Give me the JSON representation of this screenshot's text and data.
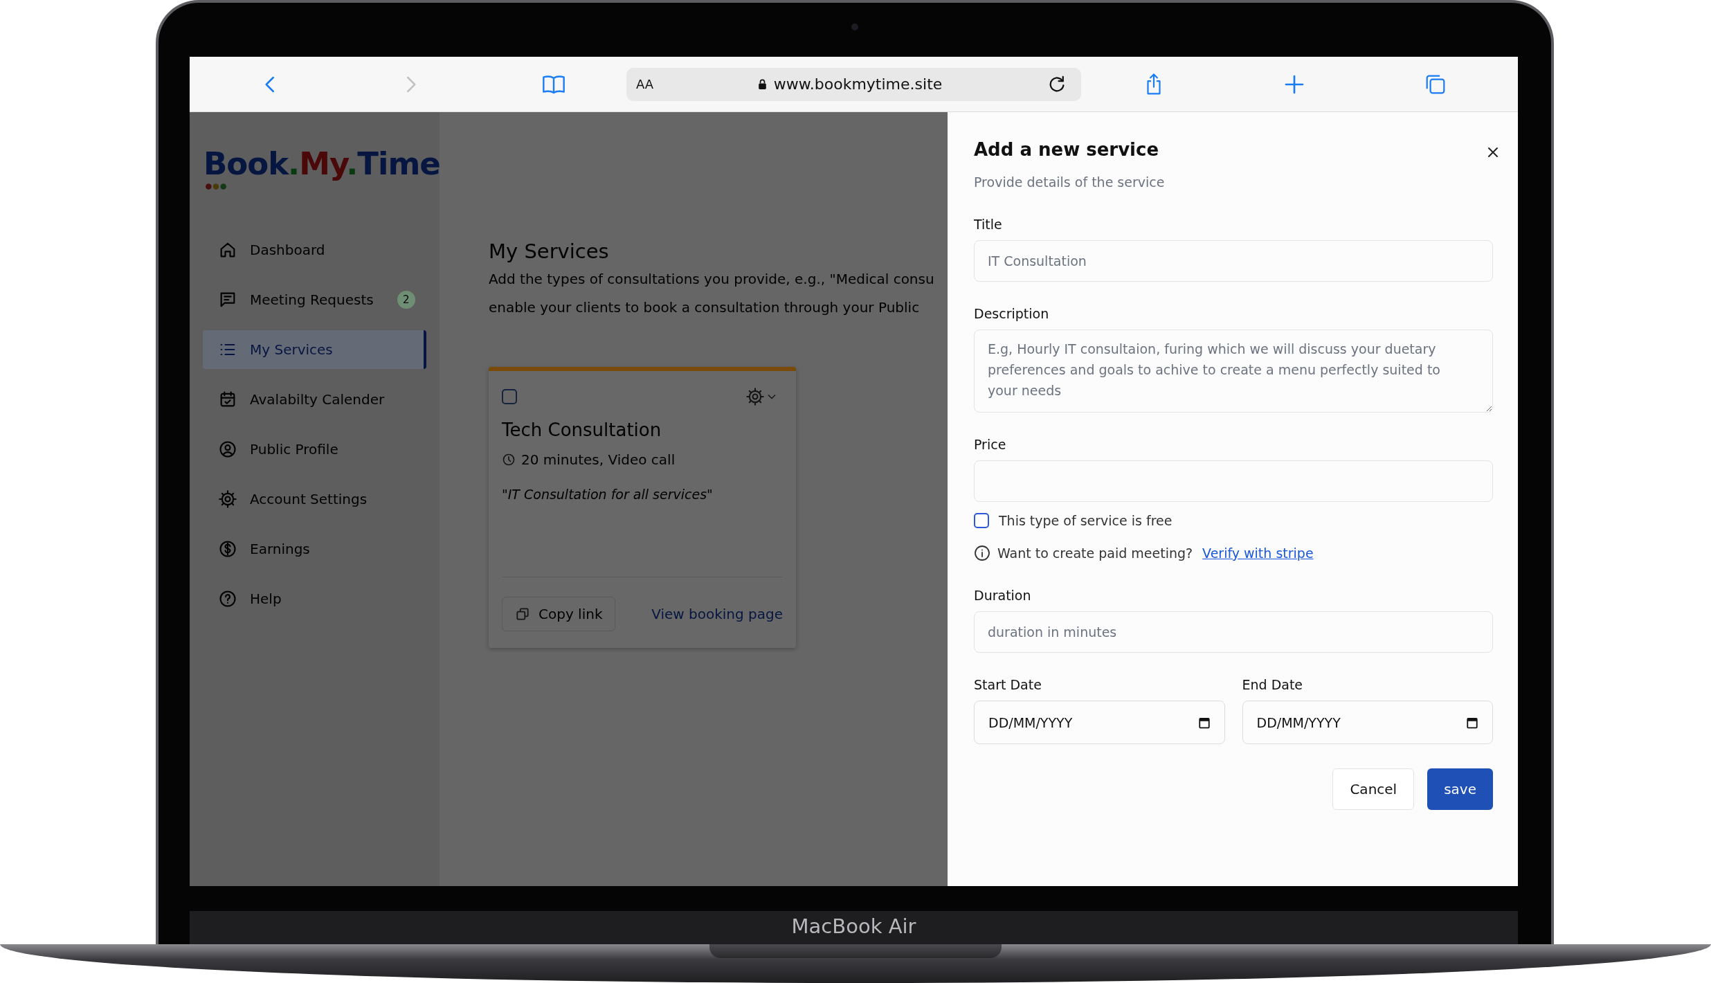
{
  "browser": {
    "reader_button": "AA",
    "url": "www.bookmytime.site"
  },
  "sidebar": {
    "logo": [
      {
        "text": "Book",
        "color": "#061640"
      },
      {
        "text": ".",
        "color": "#0a3a10"
      },
      {
        "text": "My",
        "color": "#4a0808"
      },
      {
        "text": ".",
        "color": "#0a3a10"
      },
      {
        "text": "Time",
        "color": "#061640"
      }
    ],
    "items": [
      {
        "label": "Dashboard",
        "selected": false
      },
      {
        "label": "Meeting Requests",
        "selected": false,
        "badge": "2"
      },
      {
        "label": "My Services",
        "selected": true
      },
      {
        "label": "Avalabilty Calender",
        "selected": false
      },
      {
        "label": "Public Profile",
        "selected": false
      },
      {
        "label": "Account Settings",
        "selected": false
      },
      {
        "label": "Earnings",
        "selected": false
      },
      {
        "label": "Help",
        "selected": false
      }
    ]
  },
  "page": {
    "title": "My Services",
    "description_lines": [
      "Add the types of consultations you provide, e.g., \"Medical consu",
      "enable your clients to book a consultation through your Public"
    ],
    "card": {
      "checked": false,
      "title": "Tech Consultation",
      "meta": "20 minutes, Video call",
      "quote": "\"IT Consultation for all services\"",
      "copy_button": "Copy link",
      "view_link": "View booking page"
    }
  },
  "drawer": {
    "title": "Add a new service",
    "subtitle": "Provide details of the service",
    "fields": [
      {
        "kind": "text",
        "label": "Title",
        "placeholder": "IT Consultation"
      },
      {
        "kind": "textarea",
        "label": "Description",
        "placeholder": "E.g, Hourly IT consultaion, furing which we will discuss your duetary preferences and goals to achive to create a menu perfectly suited to your needs"
      },
      {
        "kind": "text",
        "label": "Price"
      }
    ],
    "free_option": {
      "label": "This type of service is free",
      "checked": false
    },
    "paid_note": {
      "text": "Want to create paid meeting?",
      "link": "Verify with stripe"
    },
    "duration": {
      "label": "Duration",
      "placeholder": "duration in minutes"
    },
    "dates": [
      {
        "label": "Start Date",
        "value": "DD/MM/YYYY"
      },
      {
        "label": "End Date",
        "value": "DD/MM/YYYY"
      }
    ],
    "buttons": [
      {
        "label": "Cancel",
        "kind": "secondary"
      },
      {
        "label": "save",
        "kind": "primary"
      }
    ]
  },
  "device": {
    "label": "MacBook Air"
  }
}
